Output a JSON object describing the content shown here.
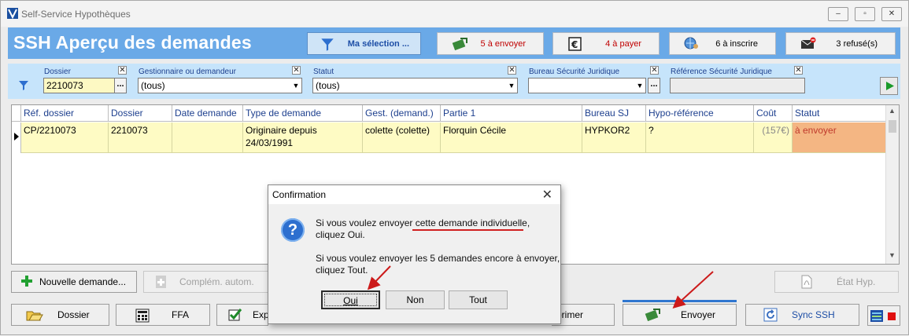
{
  "window": {
    "title": "Self-Service Hypothèques"
  },
  "header": {
    "title": "SSH  Aperçu des demandes",
    "buttons": [
      {
        "label": "Ma sélection ...",
        "icon": "funnel-icon"
      },
      {
        "label": "5 à envoyer",
        "icon": "send-money-icon"
      },
      {
        "label": "4 à payer",
        "icon": "euro-note-icon"
      },
      {
        "label": "6 à inscrire",
        "icon": "globe-user-icon"
      },
      {
        "label": "3 refusé(s)",
        "icon": "envelope-refused-icon"
      }
    ]
  },
  "filters": {
    "dossier": {
      "label": "Dossier",
      "value": "2210073"
    },
    "gestionnaire": {
      "label": "Gestionnaire ou demandeur",
      "value": "(tous)"
    },
    "statut": {
      "label": "Statut",
      "value": "(tous)"
    },
    "bureau": {
      "label": "Bureau Sécurité Juridique",
      "value": ""
    },
    "reference": {
      "label": "Référence Sécurité Juridique",
      "value": ""
    }
  },
  "grid": {
    "columns": [
      "Réf. dossier",
      "Dossier",
      "Date demande",
      "Type de demande",
      "Gest. (demand.)",
      "Partie 1",
      "Bureau SJ",
      "Hypo-référence",
      "Coût",
      "Statut"
    ],
    "rows": [
      {
        "ref": "CP/2210073",
        "dossier": "2210073",
        "date": "",
        "type": "Originaire depuis 24/03/1991",
        "gest": "colette (colette)",
        "partie": "Florquin Cécile",
        "bureau": "HYPKOR2",
        "hypo": "?",
        "cout": "(157€)",
        "statut": "à envoyer"
      }
    ]
  },
  "actions": {
    "new": "Nouvelle demande...",
    "complement": "Complém. autom.",
    "etat": "État Hyp."
  },
  "bottom": {
    "dossier": "Dossier",
    "ffa": "FFA",
    "exp": "Exp",
    "imprimer": "primer",
    "envoyer": "Envoyer",
    "sync": "Sync SSH"
  },
  "dialog": {
    "title": "Confirmation",
    "line1_pre": "Si vous voulez envoyer ",
    "line1_emph": "cette demande individuelle",
    "line1_post": ",",
    "line2": " cliquez Oui.",
    "line3": "Si vous voulez envoyer les 5 demandes encore à envoyer,",
    "line4": "cliquez Tout.",
    "oui": "Oui",
    "non": "Non",
    "tout": "Tout"
  }
}
